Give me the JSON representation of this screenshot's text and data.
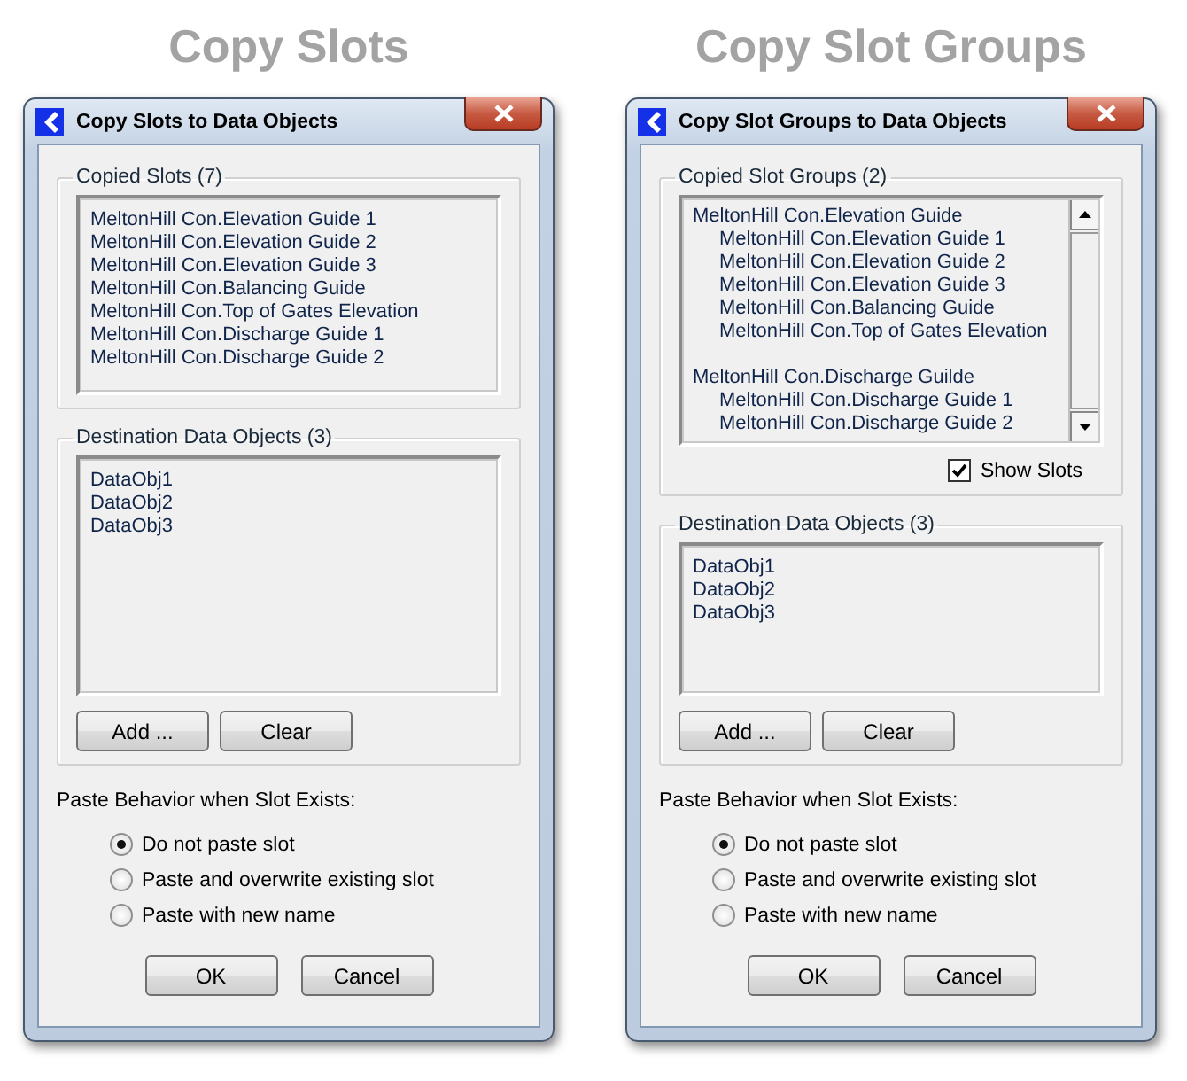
{
  "dialogs": [
    {
      "heading": "Copy Slots",
      "title": "Copy Slots to Data Objects",
      "copied": {
        "kind": "flat",
        "label": "Copied Slots (7)",
        "items": [
          "MeltonHill Con.Elevation Guide 1",
          "MeltonHill Con.Elevation Guide 2",
          "MeltonHill Con.Elevation Guide 3",
          "MeltonHill Con.Balancing Guide",
          "MeltonHill Con.Top of Gates Elevation",
          "MeltonHill Con.Discharge Guide 1",
          "MeltonHill Con.Discharge Guide 2"
        ]
      },
      "destination": {
        "label": "Destination Data Objects (3)",
        "items": [
          "DataObj1",
          "DataObj2",
          "DataObj3"
        ],
        "buttons": [
          "Add ...",
          "Clear"
        ]
      },
      "paste": {
        "label": "Paste Behavior when Slot Exists:",
        "options": [
          {
            "label": "Do not paste slot",
            "selected": true
          },
          {
            "label": "Paste and overwrite existing slot",
            "selected": false
          },
          {
            "label": "Paste with new name",
            "selected": false
          }
        ]
      },
      "buttons": [
        "OK",
        "Cancel"
      ]
    },
    {
      "heading": "Copy Slot Groups",
      "title": "Copy Slot Groups to Data Objects",
      "copied": {
        "kind": "tree",
        "label": "Copied Slot Groups (2)",
        "groups": [
          {
            "name": "MeltonHill Con.Elevation Guide",
            "children": [
              "MeltonHill Con.Elevation Guide 1",
              "MeltonHill Con.Elevation Guide 2",
              "MeltonHill Con.Elevation Guide 3",
              "MeltonHill Con.Balancing Guide",
              "MeltonHill Con.Top of Gates Elevation"
            ]
          },
          {
            "name": "MeltonHill Con.Discharge Guilde",
            "children": [
              "MeltonHill Con.Discharge Guide 1",
              "MeltonHill Con.Discharge Guide 2"
            ]
          }
        ],
        "show_slots": {
          "label": "Show Slots",
          "checked": true
        }
      },
      "destination": {
        "label": "Destination Data Objects (3)",
        "items": [
          "DataObj1",
          "DataObj2",
          "DataObj3"
        ],
        "buttons": [
          "Add ...",
          "Clear"
        ]
      },
      "paste": {
        "label": "Paste Behavior when Slot Exists:",
        "options": [
          {
            "label": "Do not paste slot",
            "selected": true
          },
          {
            "label": "Paste and overwrite existing slot",
            "selected": false
          },
          {
            "label": "Paste with new name",
            "selected": false
          }
        ]
      },
      "buttons": [
        "OK",
        "Cancel"
      ]
    }
  ]
}
